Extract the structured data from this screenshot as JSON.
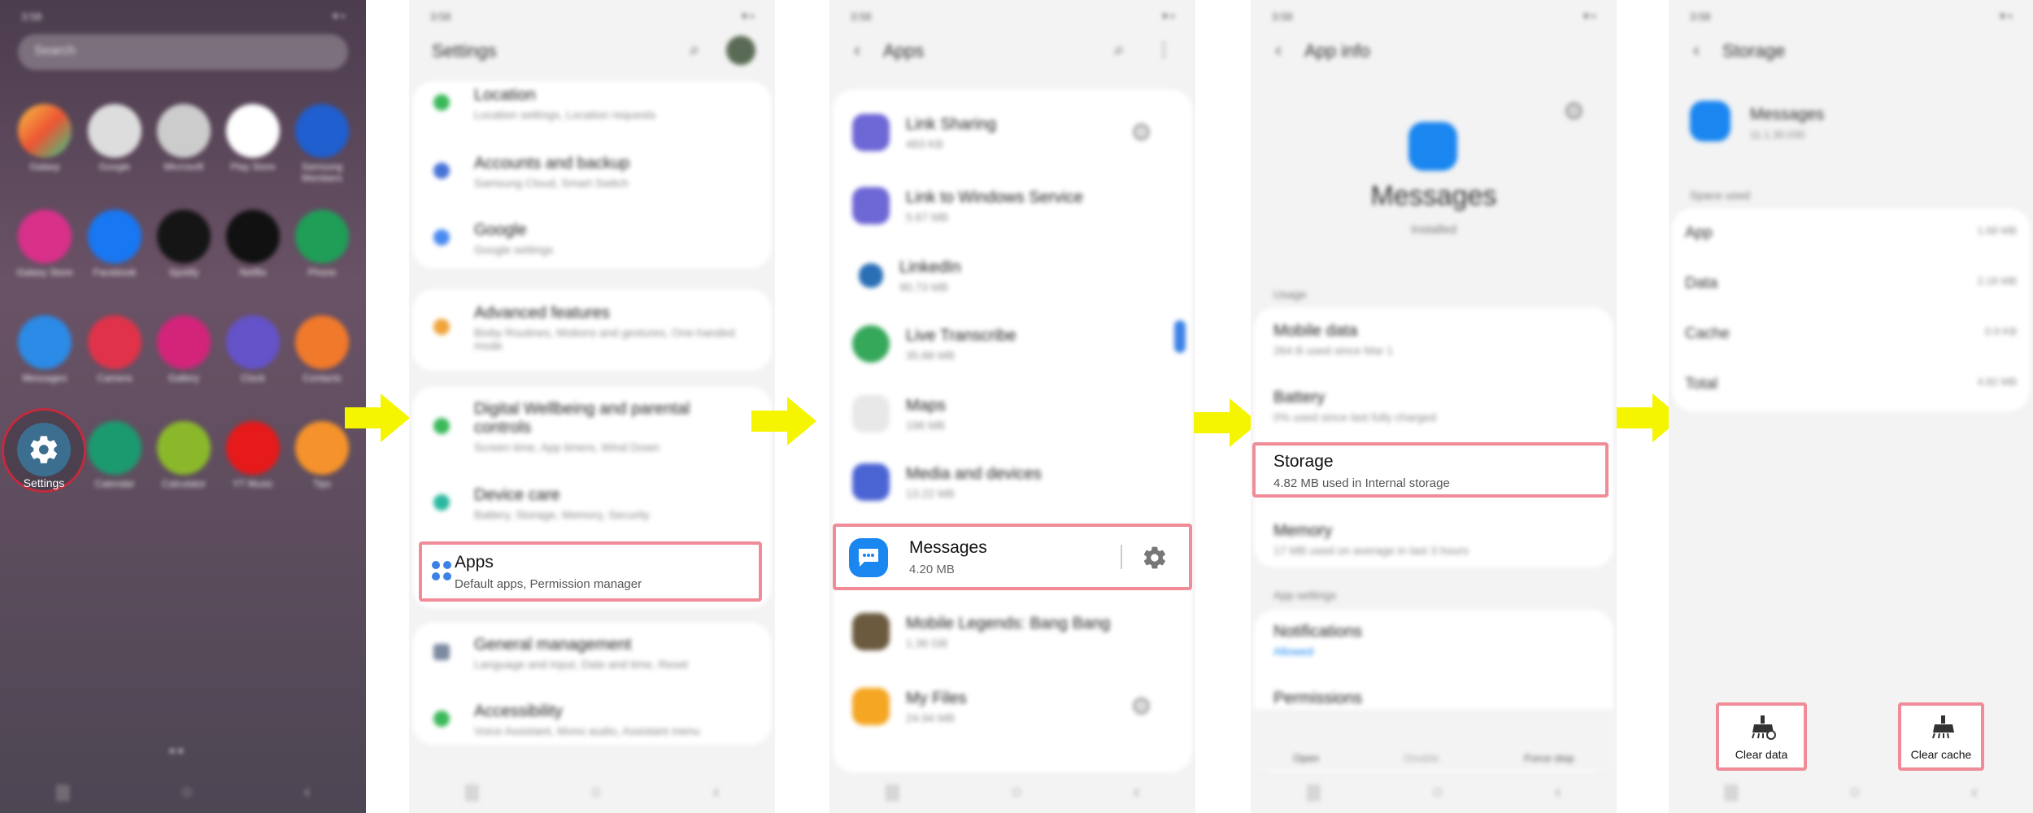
{
  "home": {
    "status_time": "3:58",
    "search_placeholder": "Search",
    "apps": [
      "Galaxy",
      "Google",
      "Microsoft",
      "Play Store",
      "Samsung Members",
      "Galaxy Store",
      "Facebook",
      "Spotify",
      "Netflix",
      "Phone",
      "Messages",
      "Camera",
      "Gallery",
      "Clock",
      "Contacts",
      "Settings",
      "Calendar",
      "Calculator",
      "YT Music",
      "Tips"
    ],
    "highlighted_app": "Settings"
  },
  "settings": {
    "status_time": "3:58",
    "title": "Settings",
    "items": [
      {
        "label": "Location",
        "sub": "Location settings, Location requests"
      },
      {
        "label": "Accounts and backup",
        "sub": "Samsung Cloud, Smart Switch"
      },
      {
        "label": "Google",
        "sub": "Google settings"
      },
      {
        "label": "Advanced features",
        "sub": "Bixby Routines, Motions and gestures, One-handed mode"
      },
      {
        "label": "Digital Wellbeing and parental controls",
        "sub": "Screen time, App timers, Wind Down"
      },
      {
        "label": "Device care",
        "sub": "Battery, Storage, Memory, Security"
      },
      {
        "label": "Apps",
        "sub": "Default apps, Permission manager"
      },
      {
        "label": "General management",
        "sub": "Language and input, Date and time, Reset"
      },
      {
        "label": "Accessibility",
        "sub": "Voice Assistant, Mono audio, Assistant menu"
      }
    ]
  },
  "apps": {
    "status_time": "3:58",
    "title": "Apps",
    "items": [
      {
        "label": "Link Sharing",
        "sub": "483 KB"
      },
      {
        "label": "Link to Windows Service",
        "sub": "5.67 MB"
      },
      {
        "label": "LinkedIn",
        "sub": "90.73 MB"
      },
      {
        "label": "Live Transcribe",
        "sub": "35.88 MB"
      },
      {
        "label": "Maps",
        "sub": "196 MB"
      },
      {
        "label": "Media and devices",
        "sub": "13.22 MB"
      },
      {
        "label": "Messages",
        "sub": "4.20 MB"
      },
      {
        "label": "Mobile Legends: Bang Bang",
        "sub": "1.36 GB"
      },
      {
        "label": "My Files",
        "sub": "24.94 MB"
      }
    ]
  },
  "appinfo": {
    "status_time": "3:58",
    "title": "App info",
    "app_name": "Messages",
    "app_status": "Installed",
    "section_usage": "Usage",
    "items": [
      {
        "label": "Mobile data",
        "sub": "264 B used since Mar 1"
      },
      {
        "label": "Battery",
        "sub": "0% used since last fully charged"
      },
      {
        "label": "Storage",
        "sub": "4.82 MB used in Internal storage"
      },
      {
        "label": "Memory",
        "sub": "17 MB used on average in last 3 hours"
      }
    ],
    "section_settings": "App settings",
    "notifications_label": "Notifications",
    "notifications_sub": "Allowed",
    "permissions_label": "Permissions",
    "bottom": [
      "Open",
      "Disable",
      "Force stop"
    ]
  },
  "storage": {
    "status_time": "3:58",
    "title": "Storage",
    "app_name": "Messages",
    "app_version": "11.1.30.030",
    "space_used_label": "Space used",
    "rows": [
      {
        "label": "App",
        "value": "1.68 MB"
      },
      {
        "label": "Data",
        "value": "2.18 MB"
      },
      {
        "label": "Cache",
        "value": "0.9 KB"
      },
      {
        "label": "Total",
        "value": "4.82 MB"
      }
    ],
    "clear_data": "Clear data",
    "clear_cache": "Clear cache"
  },
  "colors": {
    "arrow": "#f5f500",
    "highlight": "#f08c97",
    "accent": "#1a86f0"
  }
}
